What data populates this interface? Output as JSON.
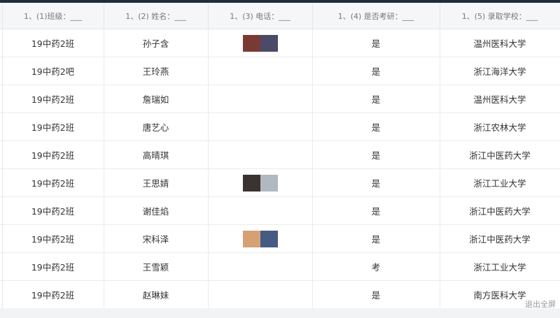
{
  "header": {
    "columns": [
      "1、(1)班级：___",
      "1、(2) 姓名：___",
      "1、(3) 电话：___",
      "1、(4) 是否考研：___",
      "1、(5) 录取学校：___"
    ]
  },
  "rows": [
    {
      "class": "19中药2班",
      "name": "孙子含",
      "exam": "是",
      "school": "温州医科大学",
      "swatches": [
        "#7a3a34",
        "#4b4a69"
      ]
    },
    {
      "class": "19中药2吧",
      "name": "王玲燕",
      "exam": "是",
      "school": "浙江海洋大学",
      "swatches": []
    },
    {
      "class": "19中药2班",
      "name": "詹瑞如",
      "exam": "是",
      "school": "温州医科大学",
      "swatches": []
    },
    {
      "class": "19中药2班",
      "name": "唐艺心",
      "exam": "是",
      "school": "浙江农林大学",
      "swatches": []
    },
    {
      "class": "19中药2班",
      "name": "高晴琪",
      "exam": "是",
      "school": "浙江中医药大学",
      "swatches": []
    },
    {
      "class": "19中药2班",
      "name": "王思婧",
      "exam": "是",
      "school": "浙江工业大学",
      "swatches": [
        "#3b332f",
        "#b0b9c1"
      ]
    },
    {
      "class": "19中药2班",
      "name": "谢佳焰",
      "exam": "是",
      "school": "浙江中医药大学",
      "swatches": []
    },
    {
      "class": "19中药2班",
      "name": "宋科泽",
      "exam": "是",
      "school": "浙江中医药大学",
      "swatches": [
        "#d6a075",
        "#475a84"
      ]
    },
    {
      "class": "19中药2班",
      "name": "王雪颖",
      "exam": "考",
      "school": "浙江工业大学",
      "swatches": []
    },
    {
      "class": "19中药2班",
      "name": "赵琳妹",
      "exam": "是",
      "school": "南方医科大学",
      "swatches": []
    }
  ],
  "footer": {
    "hint": "退出全屏"
  },
  "colors": {
    "top_bar": "#1f2d3d",
    "header_bg": "#f5f6f8",
    "grid_line": "#ebebeb"
  }
}
